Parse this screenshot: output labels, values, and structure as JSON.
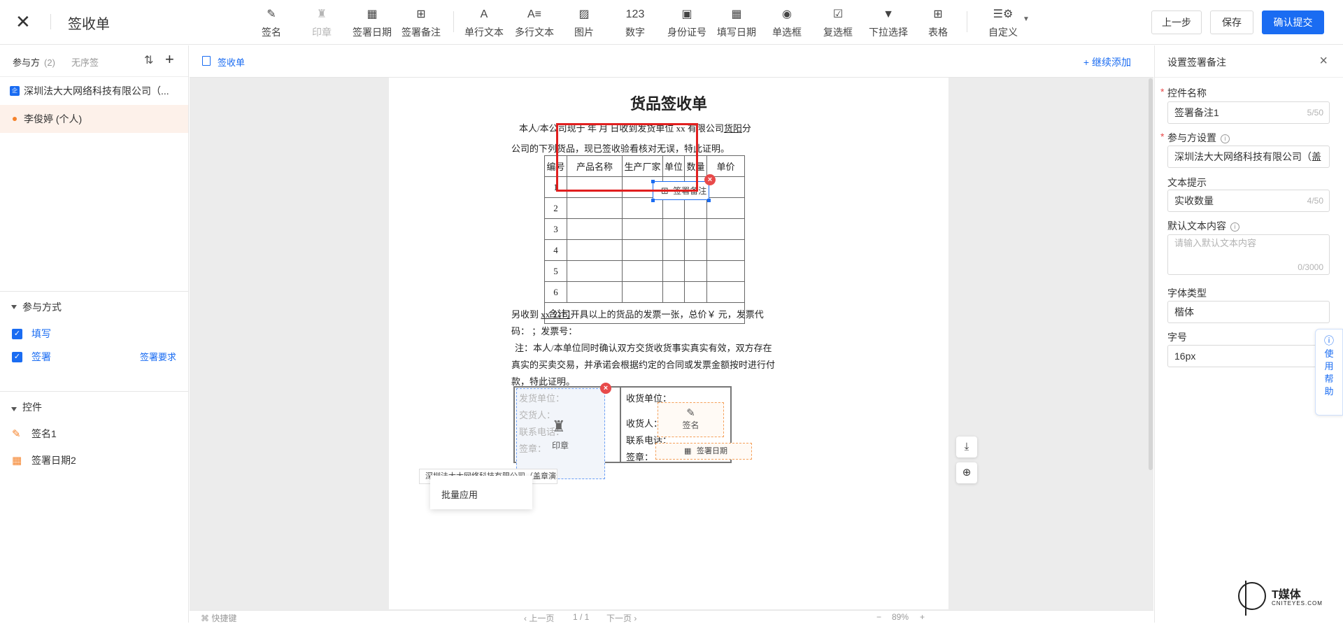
{
  "header": {
    "title": "签收单",
    "tools": [
      {
        "label": "签名",
        "icon": "pen-sign-icon",
        "glyph": "✎",
        "enabled": true
      },
      {
        "label": "印章",
        "icon": "stamp-icon",
        "glyph": "♜",
        "enabled": false
      },
      {
        "label": "签署日期",
        "icon": "calendar-icon",
        "glyph": "▦",
        "enabled": true
      },
      {
        "label": "签署备注",
        "icon": "note-plus-icon",
        "glyph": "⊞",
        "enabled": true
      },
      {
        "label": "单行文本",
        "icon": "text-a-icon",
        "glyph": "A",
        "enabled": true
      },
      {
        "label": "多行文本",
        "icon": "multiline-text-icon",
        "glyph": "A≡",
        "enabled": true
      },
      {
        "label": "图片",
        "icon": "image-icon",
        "glyph": "▨",
        "enabled": true
      },
      {
        "label": "数字",
        "icon": "number-123-icon",
        "glyph": "123",
        "enabled": true
      },
      {
        "label": "身份证号",
        "icon": "id-card-icon",
        "glyph": "▣",
        "enabled": true
      },
      {
        "label": "填写日期",
        "icon": "calendar-fill-icon",
        "glyph": "▦",
        "enabled": true
      },
      {
        "label": "单选框",
        "icon": "radio-icon",
        "glyph": "◉",
        "enabled": true
      },
      {
        "label": "复选框",
        "icon": "checkbox-icon",
        "glyph": "☑",
        "enabled": true
      },
      {
        "label": "下拉选择",
        "icon": "dropdown-icon",
        "glyph": "▼",
        "enabled": true
      },
      {
        "label": "表格",
        "icon": "table-icon",
        "glyph": "⊞",
        "enabled": true
      },
      {
        "label": "自定义",
        "icon": "custom-settings-icon",
        "glyph": "☰⚙",
        "enabled": true
      }
    ],
    "buttons": {
      "prev": "上一步",
      "save": "保存",
      "submit": "确认提交"
    }
  },
  "left_panel": {
    "party_title": "参与方",
    "party_count": "(2)",
    "no_order": "无序签",
    "parties": [
      {
        "name": "深圳法大大网络科技有限公司（...",
        "type": "company"
      },
      {
        "name": "李俊婷 (个人)",
        "type": "person"
      }
    ],
    "method_title": "参与方式",
    "methods": [
      {
        "label": "填写",
        "checked": true
      },
      {
        "label": "签署",
        "checked": true,
        "extra": "签署要求"
      }
    ],
    "controls_title": "控件",
    "controls": [
      {
        "label": "签名1",
        "icon": "pen-sign-icon"
      },
      {
        "label": "签署日期2",
        "icon": "calendar-icon"
      }
    ]
  },
  "center": {
    "doc_tab": "签收单",
    "continue_add": "继续添加",
    "document": {
      "title": "货品签收单",
      "line1": "本人/本公司现于      年    月  日收到发货单位 xx 有限公司",
      "line1_u": "货阳",
      "line1_end": "分",
      "line2": "公司的下列货品，现已签收验看核对无误，特此证明。",
      "table_headers": [
        "编号",
        "产品名称",
        "生产厂家",
        "单位",
        "数量",
        "单价"
      ],
      "table_rows": [
        "1",
        "2",
        "3",
        "4",
        "5",
        "6"
      ],
      "table_total": "合计：",
      "para1_a": "另收到 ",
      "para1_u": "xx 公司",
      "para1_b": "开具以上的货品的发票一张，总价￥       元，发票代",
      "para2": "码：     ；发票号：",
      "para3": "注：本人/本单位同时确认双方交货收货事实真实有效，双方存在",
      "para4": "真实的买卖交易，并承诺会根据约定的合同或发票金额按时进行付",
      "para5": "款，特此证明。",
      "sender_lines": [
        "发货单位：",
        "交货人：",
        "联系电话：",
        "签章："
      ],
      "receiver_lines": [
        "收货单位：",
        "收货人：",
        "联系电话：",
        "签章："
      ]
    },
    "note_control": {
      "label": "签署备注",
      "placeholder": "实收数量"
    },
    "stamp_control": {
      "label": "印章"
    },
    "sign_control": {
      "label": "签名"
    },
    "date_control": {
      "label": "签署日期"
    },
    "party_tag": "深圳法大大网络科技有限公司（盖章演示）",
    "batch_apply": "批量应用",
    "bottom": {
      "shortcut": "快捷键",
      "prev_page": "上一页",
      "page": "1 / 1",
      "next_page": "下一页",
      "zoom": "89%"
    }
  },
  "right_panel": {
    "title": "设置签署备注",
    "name_label": "控件名称",
    "name_value": "签署备注1",
    "name_count": "5/50",
    "party_label": "参与方设置",
    "party_value": "深圳法大大网络科技有限公司（盖",
    "hint_label": "文本提示",
    "hint_value": "实收数量",
    "hint_count": "4/50",
    "default_label": "默认文本内容",
    "default_placeholder": "请输入默认文本内容",
    "default_count": "0/3000",
    "font_label": "字体类型",
    "font_value": "楷体",
    "size_label": "字号",
    "size_value": "16px",
    "help": [
      "使",
      "用",
      "帮",
      "助"
    ]
  },
  "watermark": {
    "brand": "T媒体",
    "site": "CNITEYES.COM"
  },
  "colors": {
    "primary": "#1a6cf2",
    "accent_orange": "#f5822a",
    "danger": "#e84a4a",
    "highlight_red": "#e11f1f"
  }
}
